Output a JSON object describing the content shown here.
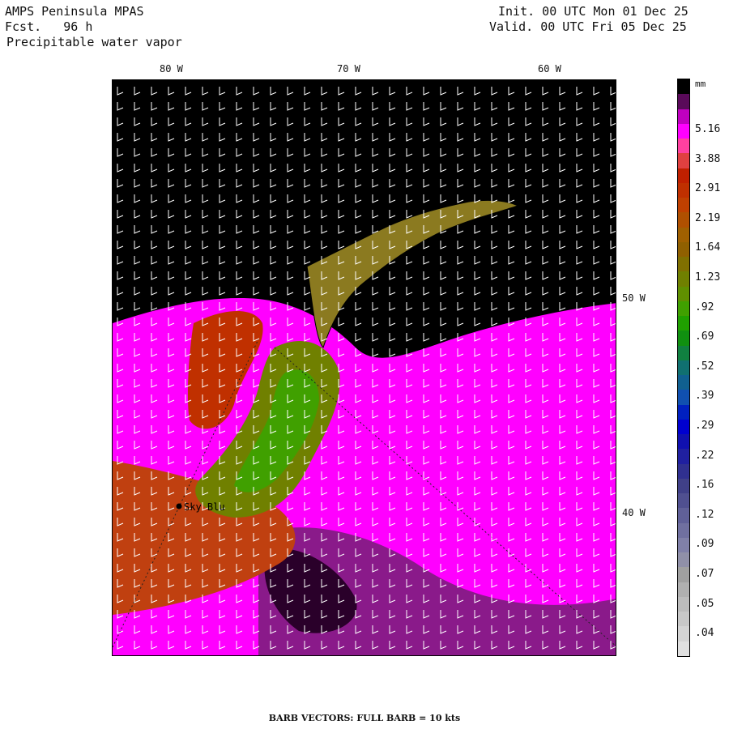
{
  "header": {
    "model": "AMPS Peninsula MPAS",
    "forecast": "Fcst.   96 h",
    "field": "Precipitable water vapor",
    "init": "Init. 00 UTC Mon 01 Dec 25",
    "valid": "Valid. 00 UTC Fri 05 Dec 25"
  },
  "axes": {
    "lon_labels": [
      "80 W",
      "70 W",
      "60 W"
    ],
    "lat_labels": [
      "50 W",
      "40 W"
    ]
  },
  "station": {
    "name": "Sky Blu"
  },
  "colorbar": {
    "unit": "mm",
    "labels": [
      "5.16",
      "3.88",
      "2.91",
      "2.19",
      "1.64",
      "1.23",
      ".92",
      ".69",
      ".52",
      ".39",
      ".29",
      ".22",
      ".16",
      ".12",
      ".09",
      ".07",
      ".05",
      ".04"
    ],
    "colors": [
      "#000000",
      "#5a0a5a",
      "#c000c0",
      "#ff00ff",
      "#ff40a0",
      "#e04040",
      "#c02000",
      "#c03000",
      "#c04000",
      "#b05000",
      "#a06000",
      "#906000",
      "#807000",
      "#708000",
      "#609000",
      "#40a000",
      "#20a000",
      "#109010",
      "#108040",
      "#107070",
      "#106090",
      "#1050b0",
      "#0020c0",
      "#0000d0",
      "#1010b0",
      "#2020a0",
      "#303090",
      "#404088",
      "#505090",
      "#606098",
      "#7070a0",
      "#8080a8",
      "#9090a8",
      "#a0a0a0",
      "#b0b0b0",
      "#bcbcbc",
      "#c8c8c8",
      "#d4d4d4",
      "#e0e0e0"
    ]
  },
  "footer": "BARB VECTORS:  FULL BARB = 10 kts"
}
